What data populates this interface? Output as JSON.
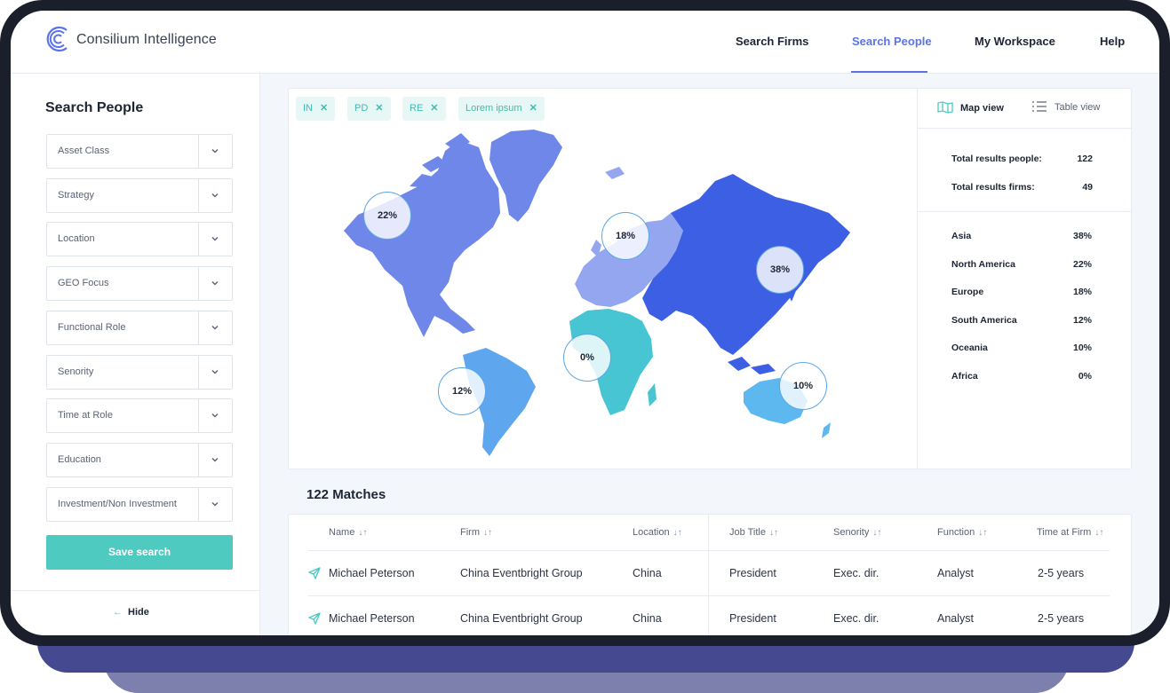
{
  "app": {
    "brand": "Consilium Intelligence",
    "nav": [
      {
        "label": "Search Firms",
        "active": false
      },
      {
        "label": "Search People",
        "active": true
      },
      {
        "label": "My Workspace",
        "active": false
      },
      {
        "label": "Help",
        "active": false
      }
    ],
    "accent_color": "#5b73e8",
    "teal_color": "#4ecac1"
  },
  "sidebar": {
    "title": "Search People",
    "filters": [
      "Asset Class",
      "Strategy",
      "Location",
      "GEO Focus",
      "Functional Role",
      "Senority",
      "Time at Role",
      "Education",
      "Investment/Non Investment"
    ],
    "save_label": "Save search",
    "hide_label": "Hide"
  },
  "map": {
    "chips": [
      "IN",
      "PD",
      "RE",
      "Lorem ipsum"
    ],
    "chip_remove_icon": "close-icon",
    "bubbles": {
      "north_america": "22%",
      "europe": "18%",
      "asia": "38%",
      "africa": "0%",
      "south_america": "12%",
      "oceania": "10%"
    },
    "view_toggle": {
      "map_label": "Map view",
      "table_label": "Table view",
      "active": "map"
    },
    "totals": [
      {
        "label": "Total results people:",
        "value": "122"
      },
      {
        "label": "Total results firms:",
        "value": "49"
      }
    ],
    "regions": [
      {
        "name": "Asia",
        "pct": "38%"
      },
      {
        "name": "North America",
        "pct": "22%"
      },
      {
        "name": "Europe",
        "pct": "18%"
      },
      {
        "name": "South America",
        "pct": "12%"
      },
      {
        "name": "Oceania",
        "pct": "10%"
      },
      {
        "name": "Africa",
        "pct": "0%"
      }
    ]
  },
  "results": {
    "matches_label": "122 Matches",
    "columns": [
      "Name",
      "Firm",
      "Location",
      "Job Title",
      "Senority",
      "Function",
      "Time at Firm"
    ],
    "rows": [
      {
        "name": "Michael Peterson",
        "firm": "China Eventbright Group",
        "location": "China",
        "job_title": "President",
        "senority": "Exec. dir.",
        "function": "Analyst",
        "time_at_firm": "2-5 years"
      },
      {
        "name": "Michael Peterson",
        "firm": "China Eventbright Group",
        "location": "China",
        "job_title": "President",
        "senority": "Exec. dir.",
        "function": "Analyst",
        "time_at_firm": "2-5 years"
      }
    ]
  }
}
